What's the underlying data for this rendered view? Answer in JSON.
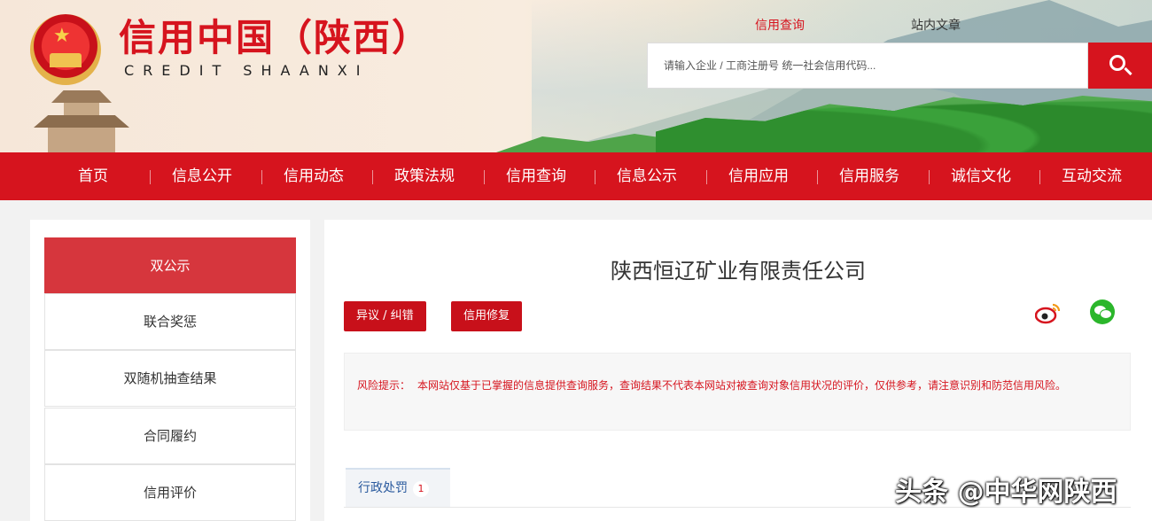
{
  "header": {
    "title": "信用中国（陕西）",
    "subtitle": "CREDIT SHAANXI",
    "top_tabs": {
      "credit_query": "信用查询",
      "site_search": "站内文章"
    },
    "search": {
      "placeholder": "请输入企业 / 工商注册号 统一社会信用代码..."
    }
  },
  "nav": {
    "items": [
      "首页",
      "信息公开",
      "信用动态",
      "政策法规",
      "信用查询",
      "信息公示",
      "信用应用",
      "信用服务",
      "诚信文化",
      "互动交流"
    ]
  },
  "sidebar": {
    "items": [
      "双公示",
      "联合奖惩",
      "双随机抽查结果",
      "合同履约",
      "信用评价"
    ],
    "active_index": 0
  },
  "main": {
    "company_name": "陕西恒辽矿业有限责任公司",
    "buttons": {
      "objection": "异议 / 纠错",
      "repair": "信用修复"
    },
    "risk": {
      "label": "风险提示：",
      "text": "本网站仅基于已掌握的信息提供查询服务，查询结果不代表本网站对被查询对象信用状况的评价，仅供参考，请注意识别和防范信用风险。"
    },
    "tabs": [
      {
        "label": "行政处罚",
        "count": "1"
      }
    ]
  },
  "watermark": "头条 @中华网陕西",
  "colors": {
    "brand_red": "#d6141e",
    "tab_blue": "#2a5a9e",
    "wechat_green": "#2bb62b"
  }
}
